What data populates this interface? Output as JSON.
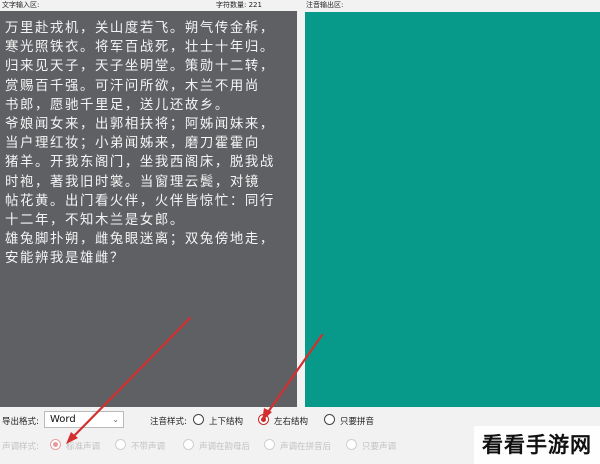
{
  "header": {
    "input_label": "文字输入区:",
    "char_count_label": "字符数量: 221",
    "output_label": "注音输出区:"
  },
  "input": {
    "text": "万里赴戎机，关山度若飞。朔气传金柝，寒光照铁衣。将军百战死，壮士十年归。\n归来见天子，天子坐明堂。策勋十二转，赏赐百千强。可汗问所欲，木兰不用尚\n书郎，愿驰千里足，送儿还故乡。\n爷娘闻女来，出郭相扶将；阿姊闻妹来，当户理红妆；小弟闻姊来，磨刀霍霍向\n猪羊。开我东阁门，坐我西阁床，脱我战时袍，著我旧时裳。当窗理云鬓，对镜\n帖花黄。出门看火伴，火伴皆惊忙：同行十二年，不知木兰是女郎。\n雄兔脚扑朔，雌兔眼迷离；双兔傍地走，安能辨我是雄雌？"
  },
  "options": {
    "export_format_label": "导出格式:",
    "export_format_value": "Word",
    "pinyin_style_label": "注音样式:",
    "pinyin_styles": [
      "上下结构",
      "左右结构",
      "只要拼音"
    ],
    "tone_style_label": "声调样式:",
    "tone_styles": [
      "标准声调",
      "不带声调",
      "声调在韵母后",
      "声调在拼音后",
      "只要声调"
    ]
  },
  "colors": {
    "input_bg": "#5f6064",
    "output_bg": "#07998a",
    "accent_red": "#c62828"
  },
  "watermark": {
    "text": "看看手游网"
  }
}
